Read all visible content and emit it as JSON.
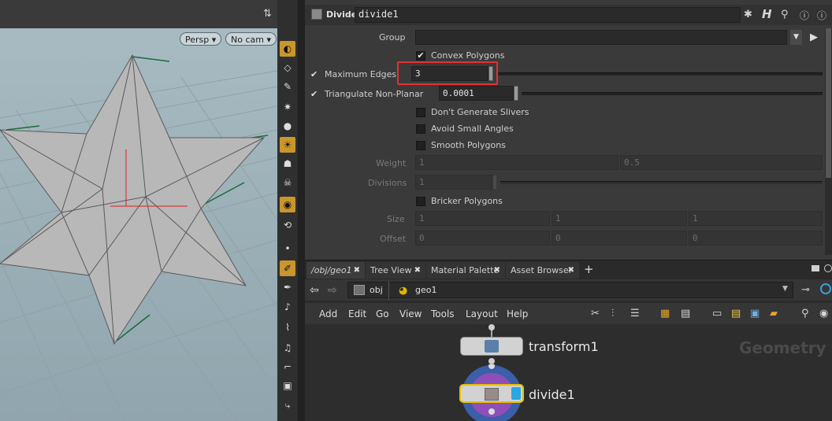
{
  "viewport": {
    "camera_view": "Persp",
    "camera": "No cam"
  },
  "param_pane": {
    "node_type": "Divide",
    "node_name": "divide1",
    "params": {
      "group_label": "Group",
      "group_value": "",
      "convex_polygons": "Convex Polygons",
      "max_edges_label": "Maximum Edges",
      "max_edges_value": "3",
      "triangulate_label": "Triangulate Non-Planar",
      "triangulate_value": "0.0001",
      "dont_generate_slivers": "Don't Generate Slivers",
      "avoid_small_angles": "Avoid Small Angles",
      "smooth_polygons": "Smooth Polygons",
      "weight_label": "Weight",
      "weight_1": "1",
      "weight_2": "0.5",
      "divisions_label": "Divisions",
      "divisions_value": "1",
      "bricker_polygons": "Bricker Polygons",
      "size_label": "Size",
      "size_x": "1",
      "size_y": "1",
      "size_z": "1",
      "offset_label": "Offset",
      "offset_x": "0",
      "offset_y": "0",
      "offset_z": "0"
    }
  },
  "tabs": [
    {
      "label": "/obj/geo1"
    },
    {
      "label": "Tree View"
    },
    {
      "label": "Material Palette"
    },
    {
      "label": "Asset Browser"
    }
  ],
  "path": {
    "level1": "obj",
    "level2": "geo1"
  },
  "menu": [
    "Add",
    "Edit",
    "Go",
    "View",
    "Tools",
    "Layout",
    "Help"
  ],
  "network": {
    "watermark": "Geometry",
    "nodes": [
      {
        "name": "transform1"
      },
      {
        "name": "divide1"
      }
    ]
  },
  "colors": {
    "highlight": "#e53030",
    "tool_active": "#c8962c",
    "selected_node_outline": "#e6c000",
    "display_flag": "#2aa7e0"
  }
}
